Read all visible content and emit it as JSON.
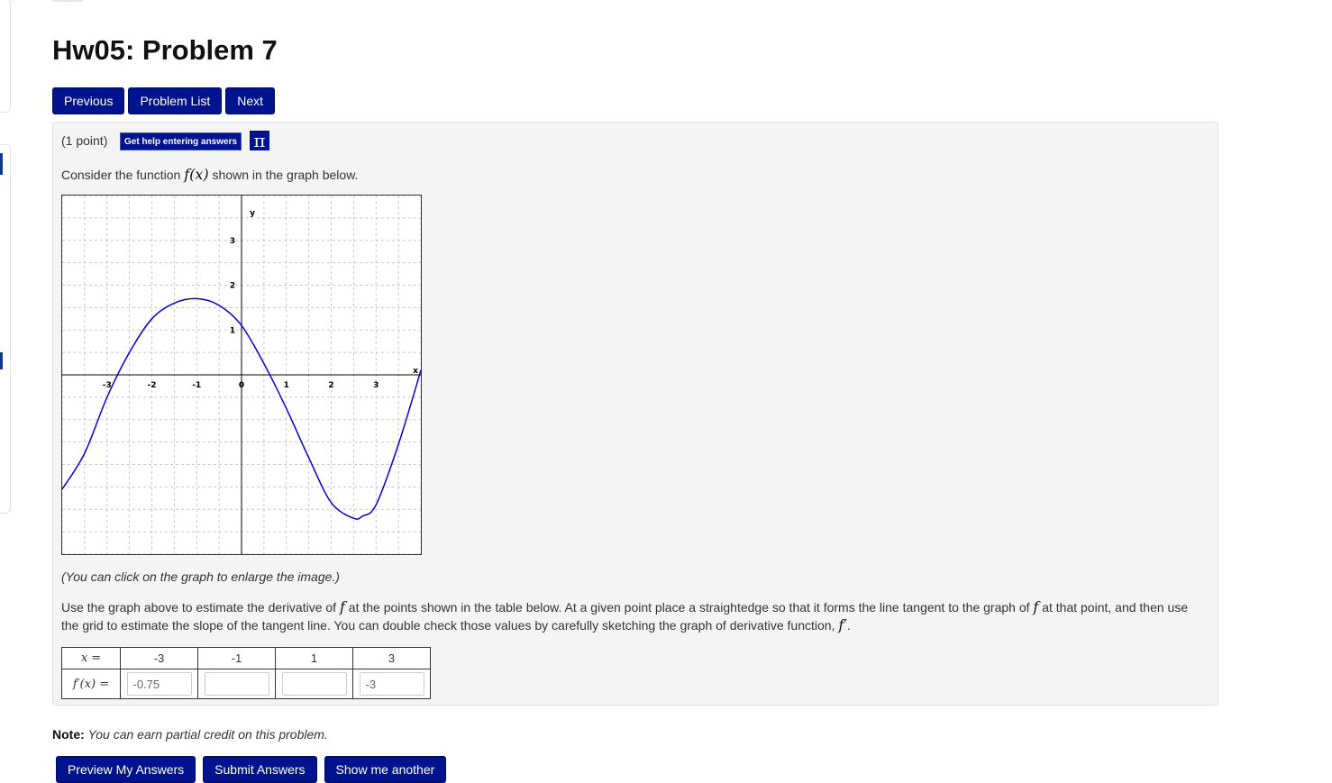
{
  "page": {
    "title": "Hw05: Problem 7"
  },
  "nav": {
    "previous": "Previous",
    "problem_list": "Problem List",
    "next": "Next"
  },
  "problem": {
    "points": "(1 point)",
    "help_button": "Get help entering answers",
    "pi_glyph": "π",
    "intro_before": "Consider the function",
    "intro_math": "f(x)",
    "intro_after": "shown in the graph below.",
    "caption": "(You can click on the graph to enlarge the image.)",
    "instr_1": "Use the graph above to estimate the derivative of",
    "instr_f": "f",
    "instr_2": "at the points shown in the table below. At a given point place a straightedge so that it forms the line tangent to the graph of",
    "instr_3": "at that point, and then use the grid to estimate the slope of the tangent line. You can double check those values by carefully sketching the graph of derivative function,",
    "instr_fprime": "f′",
    "instr_end": "."
  },
  "chart_data": {
    "type": "line",
    "xlabel": "x",
    "ylabel": "y",
    "xlim": [
      -4,
      4
    ],
    "ylim": [
      -4,
      4
    ],
    "grid": true,
    "x_ticks": [
      "-3",
      "-2",
      "-1",
      "0",
      "1",
      "2",
      "3"
    ],
    "y_ticks": [
      "1",
      "2",
      "3"
    ],
    "series": [
      {
        "color": "#0000dd",
        "x": [
          -4,
          -3.5,
          -3,
          -2.5,
          -2,
          -1.5,
          -1,
          -0.5,
          0,
          0.5,
          1,
          1.5,
          2,
          2.5,
          2.7,
          3,
          3.5,
          4
        ],
        "y": [
          -2.55,
          -1.75,
          -0.5,
          0.5,
          1.25,
          1.6,
          1.7,
          1.55,
          1.1,
          0.25,
          -0.75,
          -1.85,
          -2.85,
          -3.2,
          -3.15,
          -2.9,
          -1.55,
          0.1
        ]
      }
    ]
  },
  "table": {
    "x_header": "x =",
    "fprime_header": "f′(x) =",
    "x_values": [
      "-3",
      "-1",
      "1",
      "3"
    ],
    "answers": [
      "-0.75",
      "",
      "",
      "-3"
    ]
  },
  "note": {
    "label": "Note:",
    "text": "You can earn partial credit on this problem."
  },
  "actions": {
    "preview": "Preview My Answers",
    "submit": "Submit Answers",
    "another": "Show me another"
  }
}
